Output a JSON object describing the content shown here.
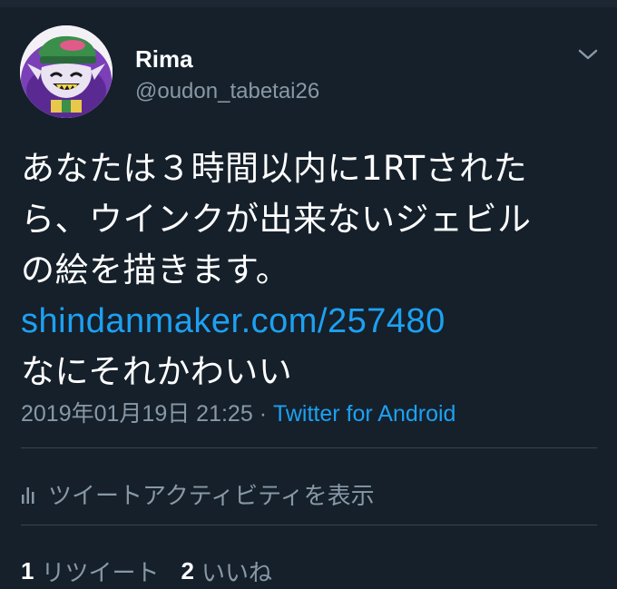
{
  "tweet": {
    "display_name": "Rima",
    "username": "@oudon_tabetai26",
    "text_lines": [
      "あなたは３時間以内に1RTされた",
      "ら、ウインクが出来ないジェビル",
      "の絵を描きます。"
    ],
    "link": "shindanmaker.com/257480",
    "text_after_link": "なにそれかわいい",
    "timestamp": "2019年01月19日 21:25",
    "separator": " · ",
    "source": "Twitter for Android"
  },
  "activity": {
    "label": "ツイートアクティビティを表示",
    "icon": "bar-chart-icon"
  },
  "stats": {
    "retweets_count": "1",
    "retweets_label": "リツイート",
    "likes_count": "2",
    "likes_label": "いいね"
  },
  "colors": {
    "background": "#15202b",
    "text": "#ffffff",
    "secondary": "#8899a6",
    "link": "#1da1f2",
    "divider": "#38444d"
  }
}
